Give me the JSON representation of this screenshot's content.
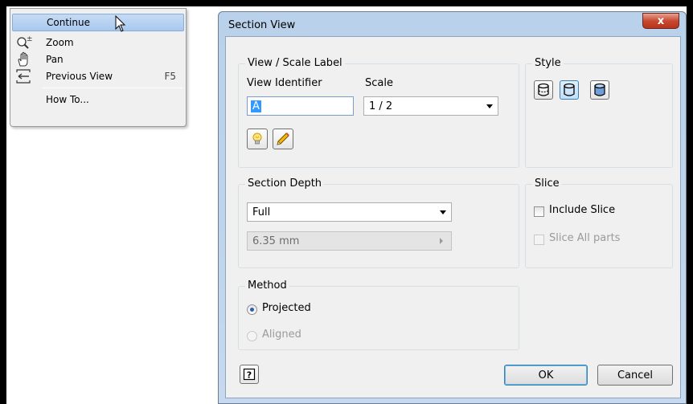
{
  "context_menu": {
    "items": [
      {
        "label": "Continue",
        "shortcut": "",
        "icon": "none",
        "highlighted": true
      },
      {
        "label": "Zoom",
        "shortcut": "",
        "icon": "zoom-icon"
      },
      {
        "label": "Pan",
        "shortcut": "",
        "icon": "pan-hand-icon"
      },
      {
        "label": "Previous View",
        "shortcut": "F5",
        "icon": "previous-view-icon"
      },
      {
        "label": "How To...",
        "shortcut": "",
        "icon": "none"
      }
    ]
  },
  "dialog": {
    "title": "Section View",
    "close_label": "x",
    "view_scale": {
      "group_label": "View / Scale Label",
      "view_identifier_label": "View Identifier",
      "view_identifier_value": "A",
      "scale_label": "Scale",
      "scale_value": "1 / 2"
    },
    "style": {
      "group_label": "Style",
      "options": [
        "hidden-lines-style-icon",
        "hidden-lines-removed-style-icon",
        "shaded-style-icon"
      ],
      "selected_index": 1
    },
    "section_depth": {
      "group_label": "Section Depth",
      "depth_value": "Full",
      "distance_value": "6.35 mm"
    },
    "slice": {
      "group_label": "Slice",
      "include_slice_label": "Include Slice",
      "include_slice_checked": false,
      "slice_all_label": "Slice All parts",
      "slice_all_checked": false
    },
    "method": {
      "group_label": "Method",
      "projected_label": "Projected",
      "aligned_label": "Aligned",
      "selected": "Projected"
    },
    "ok_label": "OK",
    "cancel_label": "Cancel"
  },
  "colors": {
    "title_bar": "#b9d1ea",
    "close_button": "#c74a30",
    "menu_highlight": "#a9c8ee",
    "selection": "#3399ff"
  }
}
